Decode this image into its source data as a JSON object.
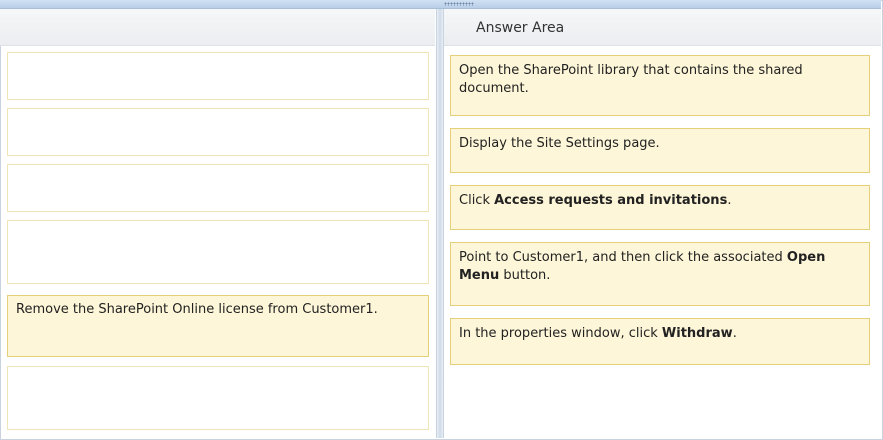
{
  "answer_area_title": "Answer Area",
  "source_slots": [
    {
      "text": ""
    },
    {
      "text": ""
    },
    {
      "text": ""
    },
    {
      "text": ""
    },
    {
      "text": "Remove the SharePoint Online license from Customer1."
    },
    {
      "text": ""
    }
  ],
  "answer_items": [
    {
      "parts": [
        {
          "t": "Open the SharePoint library that contains the shared document.",
          "bold": false
        }
      ]
    },
    {
      "parts": [
        {
          "t": "Display the Site Settings page.",
          "bold": false
        }
      ]
    },
    {
      "parts": [
        {
          "t": "Click ",
          "bold": false
        },
        {
          "t": "Access requests and invitations",
          "bold": true
        },
        {
          "t": ".",
          "bold": false
        }
      ]
    },
    {
      "parts": [
        {
          "t": "Point to Customer1, and then click the associated ",
          "bold": false
        },
        {
          "t": "Open Menu",
          "bold": true
        },
        {
          "t": " button.",
          "bold": false
        }
      ]
    },
    {
      "parts": [
        {
          "t": "In the properties window, click ",
          "bold": false
        },
        {
          "t": "Withdraw",
          "bold": true
        },
        {
          "t": ".",
          "bold": false
        }
      ]
    }
  ],
  "colors": {
    "item_bg": "#fdf6d8",
    "item_border": "#e6cf7a",
    "header_bg": "#ebedf0",
    "divider": "#cfdbe8"
  }
}
